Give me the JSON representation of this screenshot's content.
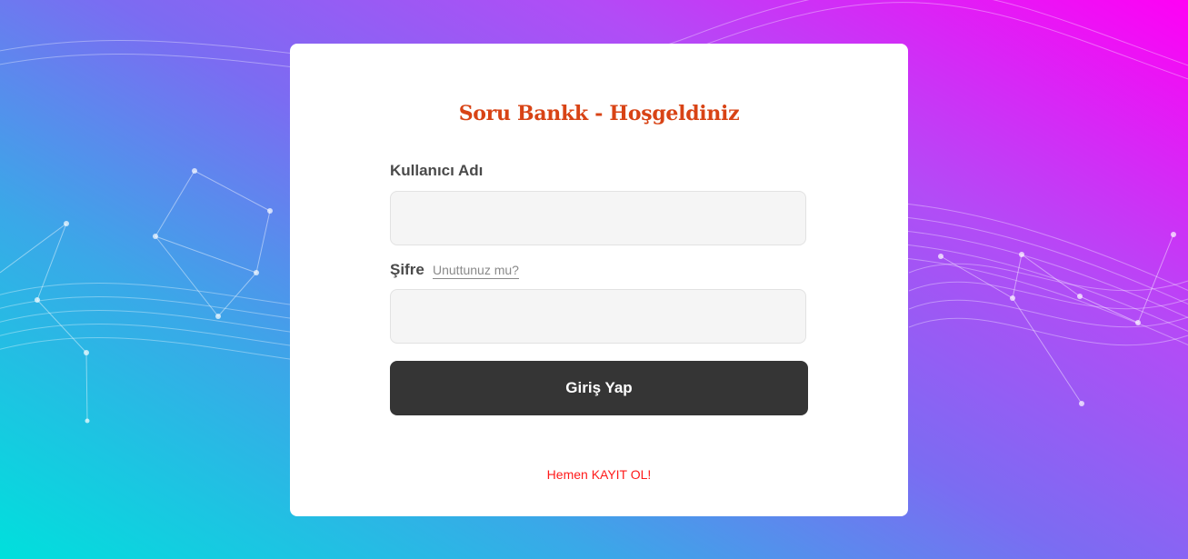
{
  "login": {
    "title": "Soru Bankk - Hoşgeldiniz",
    "username_label": "Kullanıcı Adı",
    "username_value": "",
    "password_label": "Şifre",
    "password_value": "",
    "forgot_link": "Unuttunuz mu?",
    "submit_label": "Giriş Yap",
    "register_link": "Hemen KAYIT OL!"
  },
  "colors": {
    "title": "#d84315",
    "button_bg": "#353535",
    "register": "#ff1a1a",
    "gradient_start": "#00e0dc",
    "gradient_end": "#ff00f5"
  }
}
